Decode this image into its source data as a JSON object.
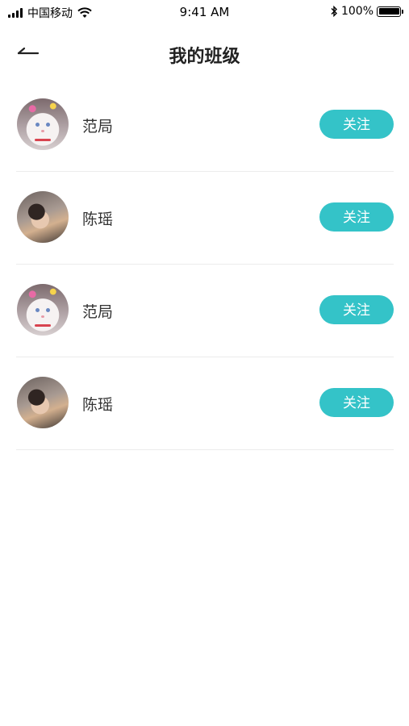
{
  "status_bar": {
    "carrier": "中国移动",
    "time": "9:41 AM",
    "battery_pct": "100%"
  },
  "nav": {
    "title": "我的班级",
    "back_icon": "back-arrow-icon"
  },
  "colors": {
    "accent": "#34c3c8",
    "divider": "#ececec",
    "text": "#222222"
  },
  "rows": [
    {
      "name": "范局",
      "avatar": "cat-avatar",
      "button": "关注"
    },
    {
      "name": "陈瑶",
      "avatar": "sleeping-person-avatar",
      "button": "关注"
    },
    {
      "name": "范局",
      "avatar": "cat-avatar",
      "button": "关注"
    },
    {
      "name": "陈瑶",
      "avatar": "sleeping-person-avatar",
      "button": "关注"
    }
  ]
}
